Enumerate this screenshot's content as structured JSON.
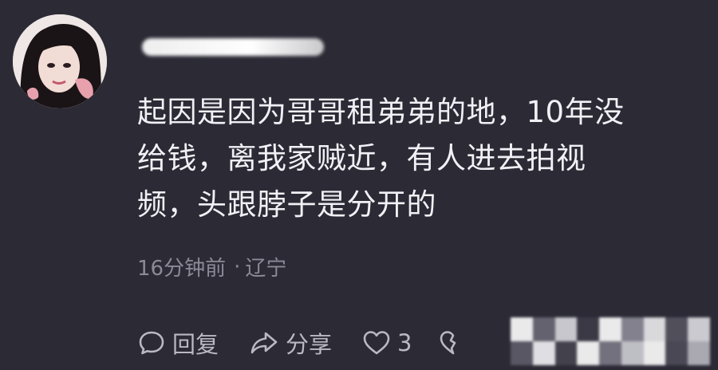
{
  "comment": {
    "body_lines": [
      "起因是因为哥哥租弟弟的地，10年没",
      "给钱，离我家贼近，有人进去拍视",
      "频，头跟脖子是分开的"
    ],
    "time": "16分钟前",
    "separator": "·",
    "location": "辽宁"
  },
  "actions": {
    "reply_label": "回复",
    "share_label": "分享",
    "like_count": "3"
  },
  "colors": {
    "background": "#2b2a35",
    "text": "#f1f0f5",
    "meta_text": "#8b8a96",
    "action_text": "#b9b8c3"
  },
  "icons": {
    "reply": "comment-bubble-icon",
    "share": "share-arrow-icon",
    "like": "heart-icon",
    "dislike": "broken-heart-icon"
  }
}
